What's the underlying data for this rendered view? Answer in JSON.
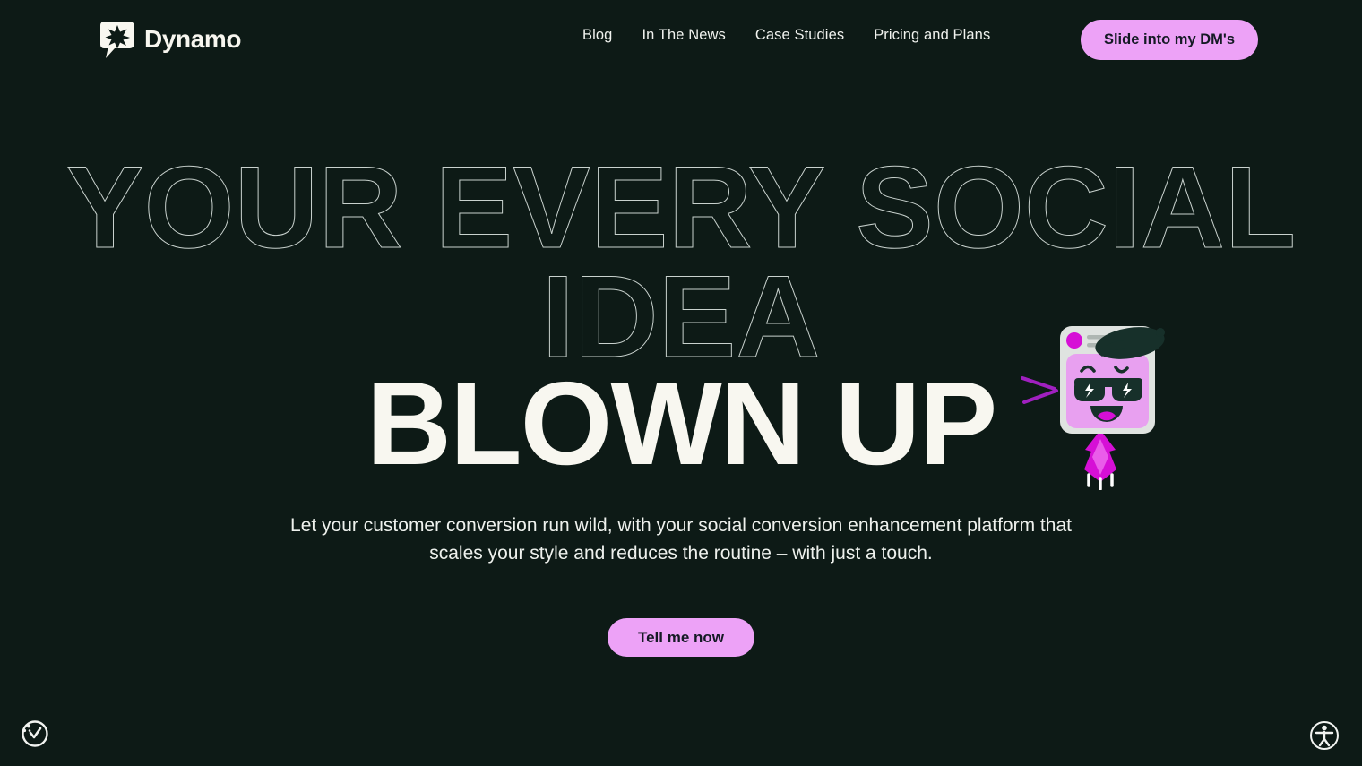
{
  "theme": {
    "background": "#0d1a16",
    "accent": "#eda2f7",
    "text_cream": "#f8f7f0",
    "outline_stroke": "#c9d2ce",
    "magenta": "#d60fd6",
    "dark_green": "#17302a"
  },
  "header": {
    "logo_text": "Dynamo",
    "logo_icon": "speech-bubble-starburst-icon",
    "nav": [
      {
        "label": "Blog"
      },
      {
        "label": "In The News"
      },
      {
        "label": "Case Studies"
      },
      {
        "label": "Pricing and Plans"
      }
    ],
    "cta_label": "Slide into my DM's"
  },
  "hero": {
    "outline_line_1": "YOUR EVERY SOCIAL",
    "outline_line_2": "IDEA",
    "filled_line": "BLOWN UP",
    "subtitle": "Let your customer conversion run wild, with your social conversion enhancement platform that scales your style and reduces the routine – with just a touch.",
    "cta_label": "Tell me now",
    "mascot": {
      "name": "social-post-mascot",
      "description": "social media post card with sunglasses face, beret, and rocket flame",
      "card_color": "#e8a0f0",
      "frame_color": "#dfe3e0",
      "avatar_color": "#d60fd6",
      "hat_color": "#17302a",
      "glasses_color": "#17302a",
      "flame_color": "#d60fd6",
      "speed_lines_color": "#a020c0"
    }
  },
  "footer": {
    "cookie_icon": "cookie-consent-icon",
    "accessibility_icon": "accessibility-person-icon"
  }
}
